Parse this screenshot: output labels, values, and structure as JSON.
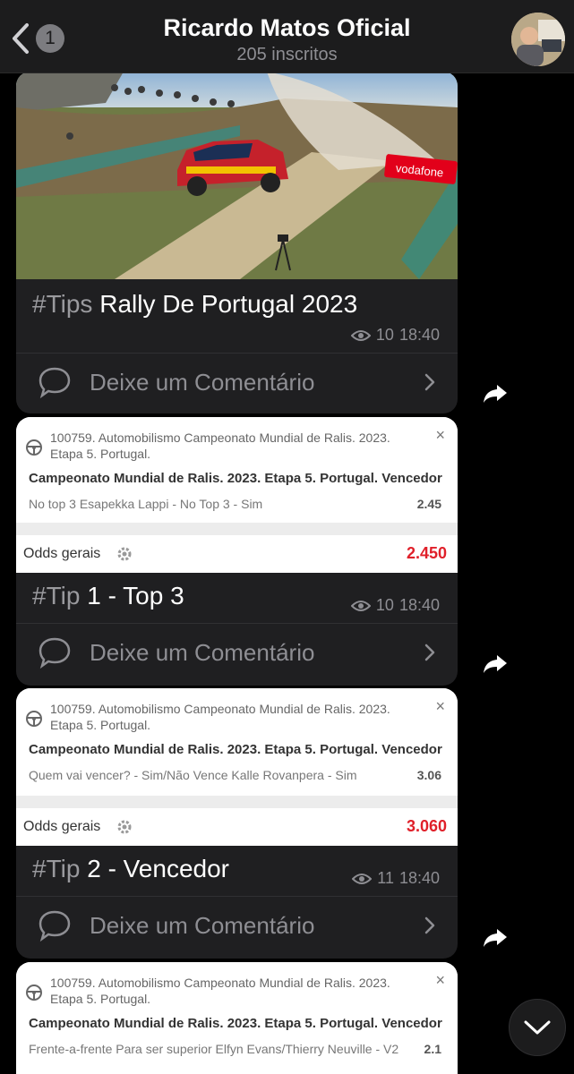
{
  "header": {
    "back_badge": "1",
    "title": "Ricardo Matos Oficial",
    "subtitle": "205 inscritos"
  },
  "colors": {
    "background": "#000000",
    "bubble": "#1f1f21",
    "odds_red": "#e0202a",
    "muted": "#8e8e93"
  },
  "messages": [
    {
      "photo_sign": "vodafone",
      "caption_tag": "#Tips",
      "caption_text": " Rally De Portugal 2023",
      "views": "10",
      "time": "18:40",
      "comment_label": "Deixe um Comentário"
    },
    {
      "slip": {
        "ref": "100759. Automobilismo Campeonato Mundial de Ralis. 2023. Etapa 5. Portugal.",
        "market": "Campeonato Mundial de Ralis. 2023. Etapa 5. Portugal. Vencedor",
        "selection": "No top 3 Esapekka Lappi - No Top 3 - Sim",
        "selection_odd": "2.45",
        "close": "×",
        "odds_label": "Odds gerais",
        "odds_total": "2.450"
      },
      "caption_tag": "#Tip",
      "caption_text": " 1 - Top 3",
      "views": "10",
      "time": "18:40",
      "comment_label": "Deixe um Comentário"
    },
    {
      "slip": {
        "ref": "100759. Automobilismo Campeonato Mundial de Ralis. 2023. Etapa 5. Portugal.",
        "market": "Campeonato Mundial de Ralis. 2023. Etapa 5. Portugal. Vencedor",
        "selection": "Quem vai vencer? - Sim/Não Vence Kalle Rovanpera - Sim",
        "selection_odd": "3.06",
        "close": "×",
        "odds_label": "Odds gerais",
        "odds_total": "3.060"
      },
      "caption_tag": "#Tip",
      "caption_text": " 2 - Vencedor",
      "views": "11",
      "time": "18:40",
      "comment_label": "Deixe um Comentário"
    },
    {
      "slip": {
        "ref": "100759. Automobilismo Campeonato Mundial de Ralis. 2023. Etapa 5. Portugal.",
        "market": "Campeonato Mundial de Ralis. 2023. Etapa 5. Portugal. Vencedor",
        "selection": "Frente-a-frente Para ser superior Elfyn Evans/Thierry Neuville - V2",
        "selection_odd": "2.1",
        "close": "×"
      }
    }
  ]
}
